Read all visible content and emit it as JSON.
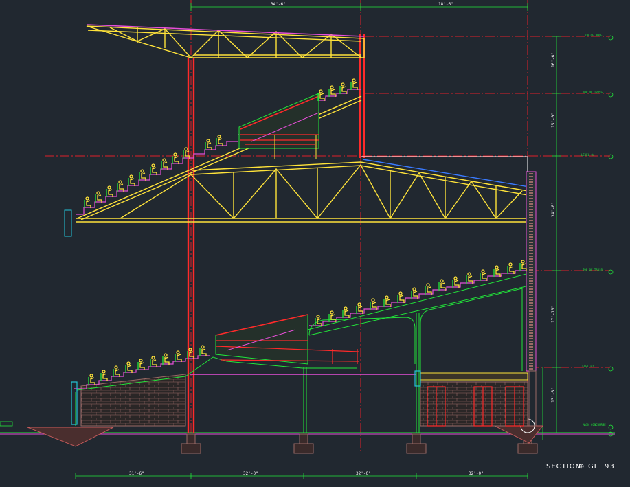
{
  "drawing": {
    "section_title": "SECTION",
    "grid_symbol": "⊕",
    "grid_prefix": "GL",
    "grid_number": "93"
  },
  "dimensions": {
    "top": [
      "34'-6\"",
      "18'-6\""
    ],
    "bottom": [
      "31'-6\"",
      "32'-0\"",
      "32'-0\"",
      "32'-0\""
    ],
    "right": [
      "16'-6\"",
      "15'-0\"",
      "34'-0\"",
      "17'-10\"",
      "13'-6\""
    ]
  },
  "levels": [
    {
      "label": "TOP OF ROOF"
    },
    {
      "label": "TOP OF TRUSS"
    },
    {
      "label": "LEVEL 04"
    },
    {
      "label": "TOP OF TRUSS"
    },
    {
      "label": "LEVEL 02"
    },
    {
      "label": "MAIN CONCOURSE"
    }
  ],
  "colors": {
    "background": "#212830",
    "truss": "#ffe33a",
    "column": "#ff2a2a",
    "slab": "#22e63a",
    "finish": "#e64fd8",
    "gridline": "#e0202a",
    "dimension": "#22e63a",
    "masonry": "#9a6a66",
    "glazing": "#23c5d8",
    "figures": "#ffe33a"
  }
}
